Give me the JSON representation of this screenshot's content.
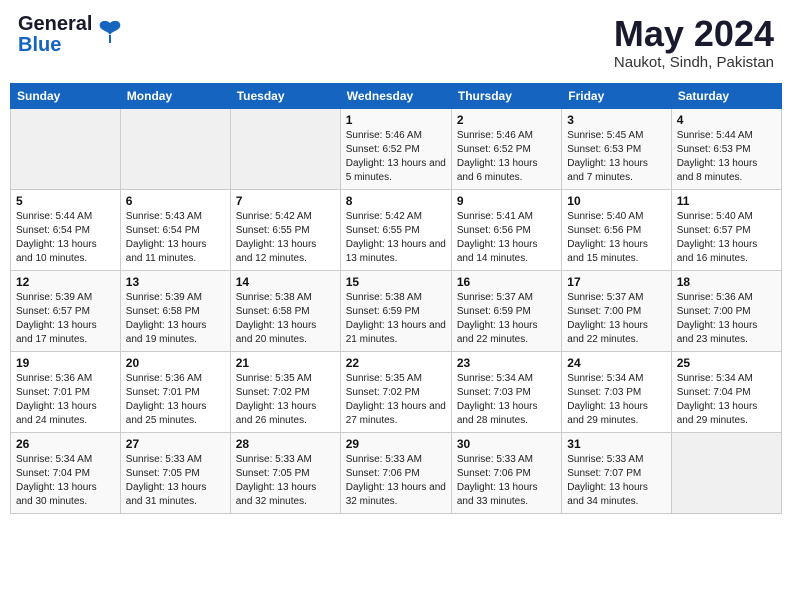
{
  "header": {
    "logo_line1": "General",
    "logo_line2": "Blue",
    "month": "May 2024",
    "location": "Naukot, Sindh, Pakistan"
  },
  "weekdays": [
    "Sunday",
    "Monday",
    "Tuesday",
    "Wednesday",
    "Thursday",
    "Friday",
    "Saturday"
  ],
  "weeks": [
    [
      {
        "day": "",
        "sunrise": "",
        "sunset": "",
        "daylight": ""
      },
      {
        "day": "",
        "sunrise": "",
        "sunset": "",
        "daylight": ""
      },
      {
        "day": "",
        "sunrise": "",
        "sunset": "",
        "daylight": ""
      },
      {
        "day": "1",
        "sunrise": "Sunrise: 5:46 AM",
        "sunset": "Sunset: 6:52 PM",
        "daylight": "Daylight: 13 hours and 5 minutes."
      },
      {
        "day": "2",
        "sunrise": "Sunrise: 5:46 AM",
        "sunset": "Sunset: 6:52 PM",
        "daylight": "Daylight: 13 hours and 6 minutes."
      },
      {
        "day": "3",
        "sunrise": "Sunrise: 5:45 AM",
        "sunset": "Sunset: 6:53 PM",
        "daylight": "Daylight: 13 hours and 7 minutes."
      },
      {
        "day": "4",
        "sunrise": "Sunrise: 5:44 AM",
        "sunset": "Sunset: 6:53 PM",
        "daylight": "Daylight: 13 hours and 8 minutes."
      }
    ],
    [
      {
        "day": "5",
        "sunrise": "Sunrise: 5:44 AM",
        "sunset": "Sunset: 6:54 PM",
        "daylight": "Daylight: 13 hours and 10 minutes."
      },
      {
        "day": "6",
        "sunrise": "Sunrise: 5:43 AM",
        "sunset": "Sunset: 6:54 PM",
        "daylight": "Daylight: 13 hours and 11 minutes."
      },
      {
        "day": "7",
        "sunrise": "Sunrise: 5:42 AM",
        "sunset": "Sunset: 6:55 PM",
        "daylight": "Daylight: 13 hours and 12 minutes."
      },
      {
        "day": "8",
        "sunrise": "Sunrise: 5:42 AM",
        "sunset": "Sunset: 6:55 PM",
        "daylight": "Daylight: 13 hours and 13 minutes."
      },
      {
        "day": "9",
        "sunrise": "Sunrise: 5:41 AM",
        "sunset": "Sunset: 6:56 PM",
        "daylight": "Daylight: 13 hours and 14 minutes."
      },
      {
        "day": "10",
        "sunrise": "Sunrise: 5:40 AM",
        "sunset": "Sunset: 6:56 PM",
        "daylight": "Daylight: 13 hours and 15 minutes."
      },
      {
        "day": "11",
        "sunrise": "Sunrise: 5:40 AM",
        "sunset": "Sunset: 6:57 PM",
        "daylight": "Daylight: 13 hours and 16 minutes."
      }
    ],
    [
      {
        "day": "12",
        "sunrise": "Sunrise: 5:39 AM",
        "sunset": "Sunset: 6:57 PM",
        "daylight": "Daylight: 13 hours and 17 minutes."
      },
      {
        "day": "13",
        "sunrise": "Sunrise: 5:39 AM",
        "sunset": "Sunset: 6:58 PM",
        "daylight": "Daylight: 13 hours and 19 minutes."
      },
      {
        "day": "14",
        "sunrise": "Sunrise: 5:38 AM",
        "sunset": "Sunset: 6:58 PM",
        "daylight": "Daylight: 13 hours and 20 minutes."
      },
      {
        "day": "15",
        "sunrise": "Sunrise: 5:38 AM",
        "sunset": "Sunset: 6:59 PM",
        "daylight": "Daylight: 13 hours and 21 minutes."
      },
      {
        "day": "16",
        "sunrise": "Sunrise: 5:37 AM",
        "sunset": "Sunset: 6:59 PM",
        "daylight": "Daylight: 13 hours and 22 minutes."
      },
      {
        "day": "17",
        "sunrise": "Sunrise: 5:37 AM",
        "sunset": "Sunset: 7:00 PM",
        "daylight": "Daylight: 13 hours and 22 minutes."
      },
      {
        "day": "18",
        "sunrise": "Sunrise: 5:36 AM",
        "sunset": "Sunset: 7:00 PM",
        "daylight": "Daylight: 13 hours and 23 minutes."
      }
    ],
    [
      {
        "day": "19",
        "sunrise": "Sunrise: 5:36 AM",
        "sunset": "Sunset: 7:01 PM",
        "daylight": "Daylight: 13 hours and 24 minutes."
      },
      {
        "day": "20",
        "sunrise": "Sunrise: 5:36 AM",
        "sunset": "Sunset: 7:01 PM",
        "daylight": "Daylight: 13 hours and 25 minutes."
      },
      {
        "day": "21",
        "sunrise": "Sunrise: 5:35 AM",
        "sunset": "Sunset: 7:02 PM",
        "daylight": "Daylight: 13 hours and 26 minutes."
      },
      {
        "day": "22",
        "sunrise": "Sunrise: 5:35 AM",
        "sunset": "Sunset: 7:02 PM",
        "daylight": "Daylight: 13 hours and 27 minutes."
      },
      {
        "day": "23",
        "sunrise": "Sunrise: 5:34 AM",
        "sunset": "Sunset: 7:03 PM",
        "daylight": "Daylight: 13 hours and 28 minutes."
      },
      {
        "day": "24",
        "sunrise": "Sunrise: 5:34 AM",
        "sunset": "Sunset: 7:03 PM",
        "daylight": "Daylight: 13 hours and 29 minutes."
      },
      {
        "day": "25",
        "sunrise": "Sunrise: 5:34 AM",
        "sunset": "Sunset: 7:04 PM",
        "daylight": "Daylight: 13 hours and 29 minutes."
      }
    ],
    [
      {
        "day": "26",
        "sunrise": "Sunrise: 5:34 AM",
        "sunset": "Sunset: 7:04 PM",
        "daylight": "Daylight: 13 hours and 30 minutes."
      },
      {
        "day": "27",
        "sunrise": "Sunrise: 5:33 AM",
        "sunset": "Sunset: 7:05 PM",
        "daylight": "Daylight: 13 hours and 31 minutes."
      },
      {
        "day": "28",
        "sunrise": "Sunrise: 5:33 AM",
        "sunset": "Sunset: 7:05 PM",
        "daylight": "Daylight: 13 hours and 32 minutes."
      },
      {
        "day": "29",
        "sunrise": "Sunrise: 5:33 AM",
        "sunset": "Sunset: 7:06 PM",
        "daylight": "Daylight: 13 hours and 32 minutes."
      },
      {
        "day": "30",
        "sunrise": "Sunrise: 5:33 AM",
        "sunset": "Sunset: 7:06 PM",
        "daylight": "Daylight: 13 hours and 33 minutes."
      },
      {
        "day": "31",
        "sunrise": "Sunrise: 5:33 AM",
        "sunset": "Sunset: 7:07 PM",
        "daylight": "Daylight: 13 hours and 34 minutes."
      },
      {
        "day": "",
        "sunrise": "",
        "sunset": "",
        "daylight": ""
      }
    ]
  ]
}
